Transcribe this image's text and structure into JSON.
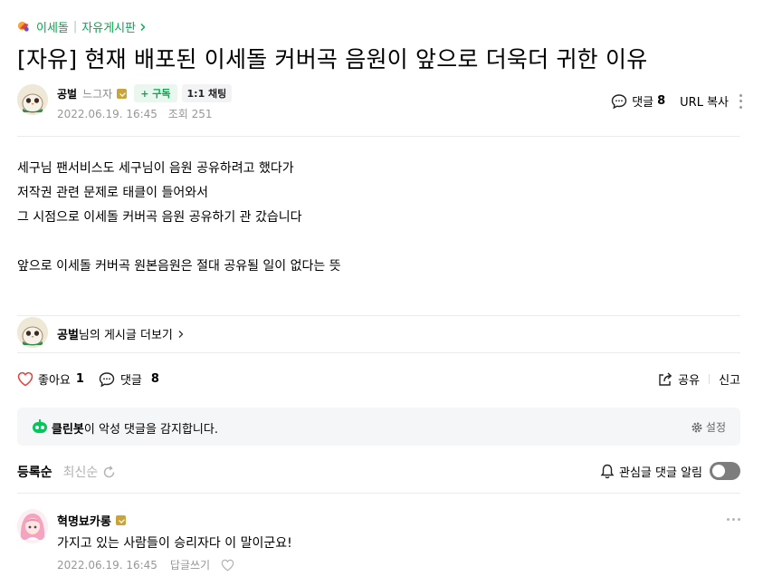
{
  "cafe": {
    "name": "이세돌",
    "board": "자유게시판"
  },
  "post": {
    "title": "[자유] 현재 배포된 이세돌 커버곡 음원이 앞으로 더욱더 귀한 이유",
    "author": "공벌",
    "author_level": "느그자",
    "subscribe_label": "+ 구독",
    "chat_label": "1:1 채팅",
    "date": "2022.06.19. 16:45",
    "views_label": "조회 251",
    "comments_label": "댓글",
    "comments_count": "8",
    "url_copy_label": "URL 복사",
    "body_lines": [
      "세구님 팬서비스도 세구님이 음원 공유하려고 했다가",
      "저작권 관련 문제로 태클이 들어와서",
      "그 시점으로 이세돌 커버곡 음원 공유하기 관 갔습니다",
      "",
      "앞으로 이세돌 커버곡 원본음원은 절대 공유될 일이 없다는 뜻"
    ],
    "more_posts_name": "공벌",
    "more_posts_suffix": "님의 게시글 더보기"
  },
  "reactions": {
    "like_label": "좋아요",
    "like_count": "1",
    "comment_label": "댓글",
    "comment_count": "8",
    "share_label": "공유",
    "report_label": "신고"
  },
  "cleanbot": {
    "name": "클린봇",
    "message": "이 악성 댓글을 감지합니다.",
    "settings_label": "설정"
  },
  "comments_section": {
    "sort_active": "등록순",
    "sort_inactive": "최신순",
    "alarm_label": "관심글 댓글 알림",
    "alarm_on": false
  },
  "comments": [
    {
      "author": "혁명뵤카롱",
      "text": "가지고 있는 사람들이 승리자다 이 말이군요!",
      "date": "2022.06.19. 16:45",
      "reply_label": "답글쓰기"
    }
  ],
  "colors": {
    "accent": "#03a94d",
    "like": "#e8403c",
    "muted": "#979797"
  }
}
